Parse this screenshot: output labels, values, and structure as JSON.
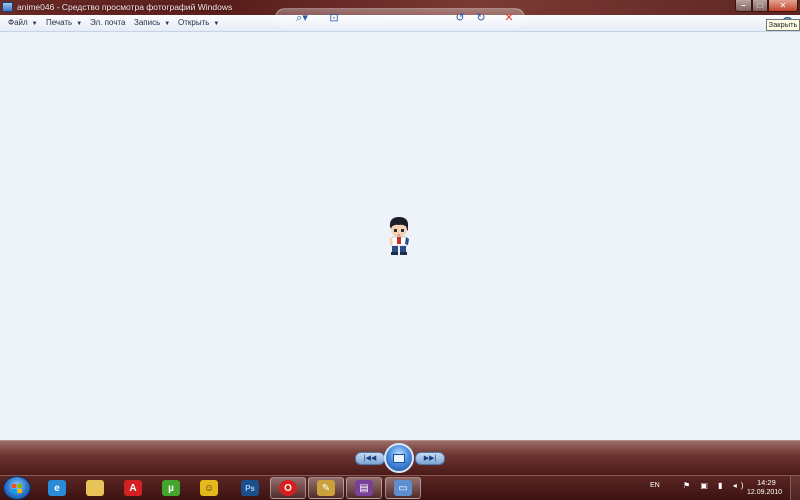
{
  "window": {
    "title": "anime046 - Средство просмотра фотографий Windows",
    "min_glyph": "–",
    "max_glyph": "□",
    "close_glyph": "✕"
  },
  "menu": {
    "items": [
      {
        "label": "Файл",
        "caret": "▼"
      },
      {
        "label": "Печать",
        "caret": "▼"
      },
      {
        "label": "Эл. почта",
        "caret": ""
      },
      {
        "label": "Запись",
        "caret": "▼"
      },
      {
        "label": "Открыть",
        "caret": "▼"
      }
    ]
  },
  "tooltip": {
    "text": "Закрыть"
  },
  "controls": {
    "zoom": "⌕▾",
    "fit": "⊡",
    "prev": "|◀◀",
    "next": "▶▶|",
    "rotate_ccw": "↺",
    "rotate_cw": "↻",
    "delete": "✕"
  },
  "taskbar": {
    "apps": [
      {
        "name": "internet-explorer",
        "glyph": "e",
        "color": "#2a8ad8"
      },
      {
        "name": "explorer-folder",
        "glyph": "",
        "color": "#e8c35a"
      },
      {
        "name": "avira",
        "glyph": "A",
        "color": "#d42020"
      },
      {
        "name": "utorrent",
        "glyph": "µ",
        "color": "#43a52e"
      },
      {
        "name": "icq",
        "glyph": "☺",
        "color": "#e6b81c"
      },
      {
        "name": "photoshop",
        "glyph": "Ps",
        "color": "#1b4f8a"
      },
      {
        "name": "opera",
        "glyph": "O",
        "color": "#d51f1f"
      },
      {
        "name": "media-app",
        "glyph": "✎",
        "color": "#caa13a"
      },
      {
        "name": "winrar",
        "glyph": "▤",
        "color": "#7a3f96"
      },
      {
        "name": "photo-viewer",
        "glyph": "▭",
        "color": "#5d8fd0"
      }
    ],
    "tray": {
      "lang": "EN",
      "icons": "⚑ ▣ ▮ ◂)",
      "time": "14:29",
      "date": "12.09.2010"
    }
  },
  "colors": {
    "titlebar": "#5a1f1c",
    "canvas": "#eef3fa",
    "taskbar": "#3c1210"
  }
}
